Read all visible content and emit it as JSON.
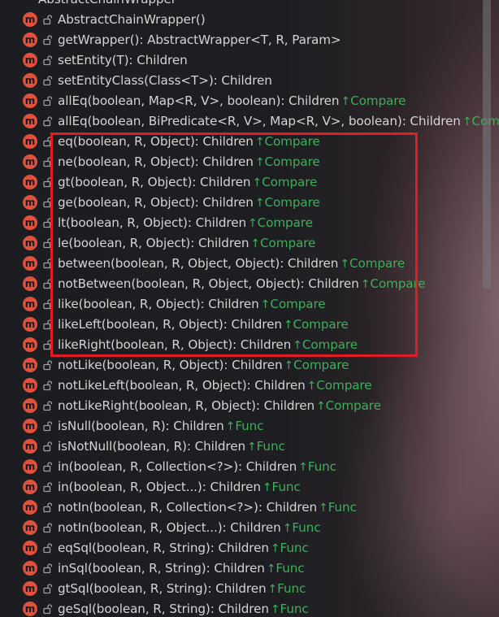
{
  "class_header": {
    "title": "AbstractChainWrapper"
  },
  "members": [
    {
      "name": "AbstractChainWrapper()",
      "ret": "",
      "tag": ""
    },
    {
      "name": "getWrapper(): AbstractWrapper<T, R, Param>",
      "ret": "",
      "tag": ""
    },
    {
      "name": "setEntity(T): Children",
      "ret": "",
      "tag": ""
    },
    {
      "name": "setEntityClass(Class<T>): Children",
      "ret": "",
      "tag": ""
    },
    {
      "name": "allEq(boolean, Map<R, V>, boolean): Children",
      "ret": "",
      "tag": "Compare"
    },
    {
      "name": "allEq(boolean, BiPredicate<R, V>, Map<R, V>, boolean): Children",
      "ret": "",
      "tag": "Compa"
    },
    {
      "name": "eq(boolean, R, Object): Children",
      "ret": "",
      "tag": "Compare"
    },
    {
      "name": "ne(boolean, R, Object): Children",
      "ret": "",
      "tag": "Compare"
    },
    {
      "name": "gt(boolean, R, Object): Children",
      "ret": "",
      "tag": "Compare"
    },
    {
      "name": "ge(boolean, R, Object): Children",
      "ret": "",
      "tag": "Compare"
    },
    {
      "name": "lt(boolean, R, Object): Children",
      "ret": "",
      "tag": "Compare"
    },
    {
      "name": "le(boolean, R, Object): Children",
      "ret": "",
      "tag": "Compare"
    },
    {
      "name": "between(boolean, R, Object, Object): Children",
      "ret": "",
      "tag": "Compare"
    },
    {
      "name": "notBetween(boolean, R, Object, Object): Children",
      "ret": "",
      "tag": "Compare"
    },
    {
      "name": "like(boolean, R, Object): Children",
      "ret": "",
      "tag": "Compare"
    },
    {
      "name": "likeLeft(boolean, R, Object): Children",
      "ret": "",
      "tag": "Compare"
    },
    {
      "name": "likeRight(boolean, R, Object): Children",
      "ret": "",
      "tag": "Compare"
    },
    {
      "name": "notLike(boolean, R, Object): Children",
      "ret": "",
      "tag": "Compare"
    },
    {
      "name": "notLikeLeft(boolean, R, Object): Children",
      "ret": "",
      "tag": "Compare"
    },
    {
      "name": "notLikeRight(boolean, R, Object): Children",
      "ret": "",
      "tag": "Compare"
    },
    {
      "name": "isNull(boolean, R): Children",
      "ret": "",
      "tag": "Func"
    },
    {
      "name": "isNotNull(boolean, R): Children",
      "ret": "",
      "tag": "Func"
    },
    {
      "name": "in(boolean, R, Collection<?>): Children",
      "ret": "",
      "tag": "Func"
    },
    {
      "name": "in(boolean, R, Object...): Children",
      "ret": "",
      "tag": "Func"
    },
    {
      "name": "notIn(boolean, R, Collection<?>): Children",
      "ret": "",
      "tag": "Func"
    },
    {
      "name": "notIn(boolean, R, Object...): Children",
      "ret": "",
      "tag": "Func"
    },
    {
      "name": "eqSql(boolean, R, String): Children",
      "ret": "",
      "tag": "Func"
    },
    {
      "name": "inSql(boolean, R, String): Children",
      "ret": "",
      "tag": "Func"
    },
    {
      "name": "gtSql(boolean, R, String): Children",
      "ret": "",
      "tag": "Func"
    },
    {
      "name": "geSql(boolean, R, String): Children",
      "ret": "",
      "tag": "Func"
    }
  ],
  "icons": {
    "method": "method-icon",
    "visibility": "lock-open-icon",
    "inherited_arrow": "up-arrow-icon"
  },
  "icon_glyphs": {
    "method_letter": "m",
    "inherited_arrow": "↑"
  },
  "colors": {
    "method_icon": "#e0503c",
    "text": "#d4d4d4",
    "inherited_tag": "#3fae5a",
    "highlight": "#e01c24",
    "background": "#1f2024"
  }
}
